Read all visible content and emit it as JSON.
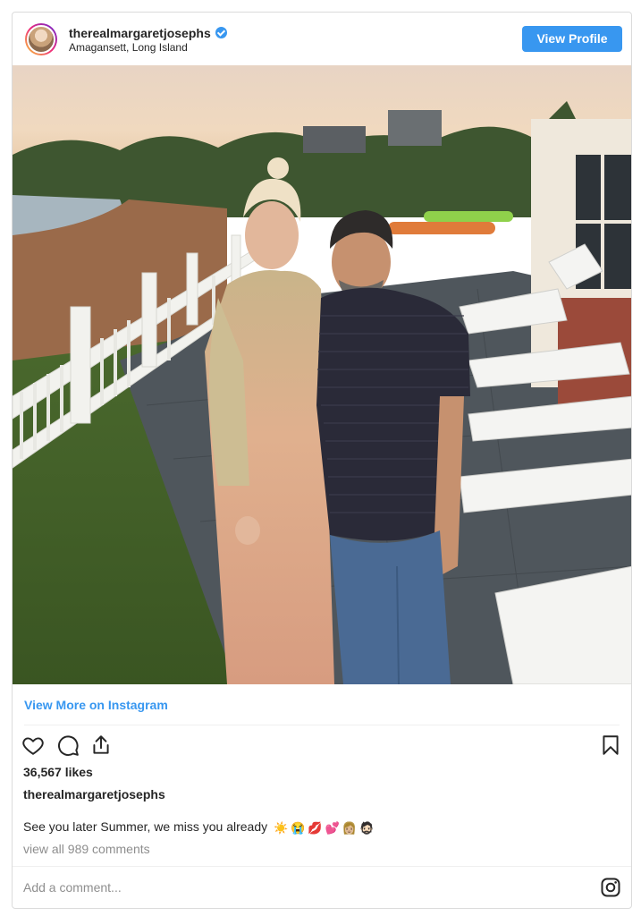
{
  "header": {
    "username": "therealmargaretjosephs",
    "location": "Amagansett, Long Island",
    "view_profile_label": "View Profile"
  },
  "post": {
    "view_more_label": "View More on Instagram",
    "likes": "36,567 likes",
    "caption_user": "therealmargaretjosephs",
    "caption_text": "See you later Summer, we miss you already",
    "caption_emojis": [
      "☀️",
      "😭",
      "💋",
      "💕",
      "👩🏼",
      "🧔🏻"
    ],
    "view_comments": "view all 989 comments"
  },
  "comment": {
    "placeholder": "Add a comment..."
  },
  "colors": {
    "accent": "#3897f0",
    "border": "#dbdbdb",
    "text": "#262626",
    "muted": "#8e8e8e"
  },
  "icons": [
    "heart-icon",
    "comment-icon",
    "share-icon",
    "bookmark-icon",
    "instagram-icon",
    "verified-icon"
  ]
}
